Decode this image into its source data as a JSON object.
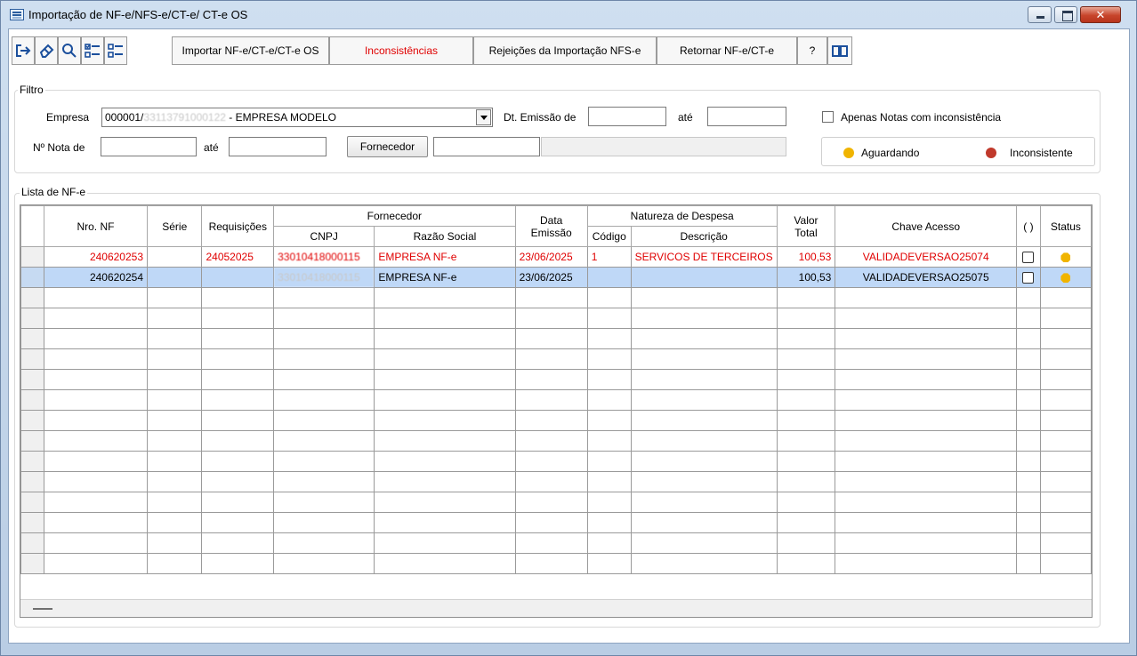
{
  "window": {
    "title": "Importação de NF-e/NFS-e/CT-e/ CT-e OS"
  },
  "toolbar": {
    "icons": [
      "exit-icon",
      "eraser-icon",
      "search-icon",
      "checklist-icon",
      "list-icon"
    ],
    "import_label": "Importar NF-e/CT-e/CT-e OS",
    "inconsistencies_label": "Inconsistências",
    "rejections_label": "Rejeições da Importação NFS-e",
    "return_label": "Retornar NF-e/CT-e",
    "help_label": "?",
    "manual_icon": "book-icon"
  },
  "filter": {
    "group_label": "Filtro",
    "empresa_label": "Empresa",
    "empresa_code": "000001/",
    "empresa_cnpj_blurred": "33113791000122",
    "empresa_name": " - EMPRESA MODELO",
    "dt_emissao_label": "Dt. Emissão de",
    "ate_label_1": "até",
    "nota_label": "Nº Nota de",
    "ate_label_2": "até",
    "fornecedor_button": "Fornecedor",
    "only_inconsistent_label": "Apenas Notas com inconsistência",
    "legend_waiting": "Aguardando",
    "legend_inconsistent": "Inconsistente",
    "colors": {
      "waiting": "#f0b400",
      "inconsistent": "#c0392b"
    }
  },
  "list": {
    "group_label": "Lista de NF-e",
    "headers": {
      "nro": "Nro. NF",
      "serie": "Série",
      "requisicoes": "Requisições",
      "fornecedor": "Fornecedor",
      "cnpj": "CNPJ",
      "razao": "Razão Social",
      "data_l1": "Data",
      "data_l2": "Emissão",
      "natureza": "Natureza de Despesa",
      "codigo": "Código",
      "descricao": "Descrição",
      "valor_l1": "Valor",
      "valor_l2": "Total",
      "chave": "Chave Acesso",
      "sel": "( )",
      "status": "Status"
    },
    "rows": [
      {
        "nro": "240620253",
        "serie": "",
        "requisicoes": "24052025",
        "cnpj": "33010418000115",
        "razao": "EMPRESA NF-e",
        "data": "23/06/2025",
        "codigo": "1",
        "descricao": "SERVICOS DE TERCEIROS",
        "valor": "100,53",
        "chave": "VALIDADEVERSAO25074",
        "status": "Aguardando",
        "inconsistent": true
      },
      {
        "nro": "240620254",
        "serie": "",
        "requisicoes": "",
        "cnpj": "33010418000115",
        "razao": "EMPRESA NF-e",
        "data": "23/06/2025",
        "codigo": "",
        "descricao": "",
        "valor": "100,53",
        "chave": "VALIDADEVERSAO25075",
        "status": "Aguardando",
        "inconsistent": false
      }
    ]
  }
}
